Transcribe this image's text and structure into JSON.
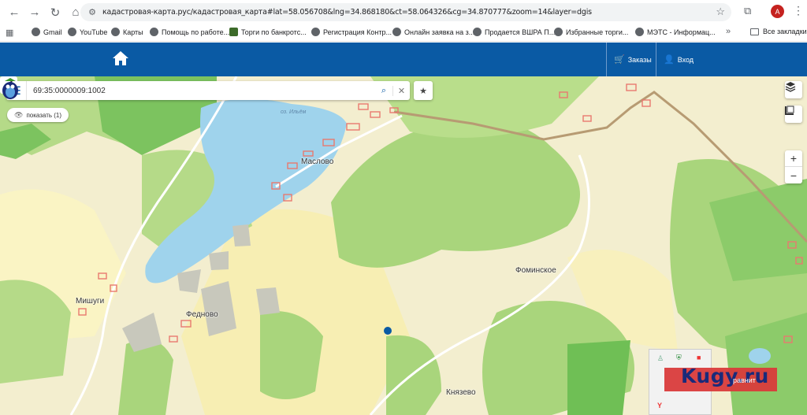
{
  "browser": {
    "url": "кадастровая-карта.рус/кадастровая_карта#lat=58.056708&lng=34.868180&ct=58.064326&cg=34.870777&zoom=14&layer=dgis",
    "avatar_letter": "A",
    "bookmarks": [
      "Gmail",
      "YouTube",
      "Карты",
      "Помощь по работе...",
      "Торги по банкротс...",
      "Регистрация Контр...",
      "Онлайн заявка на з...",
      "Продается ВШРА П...",
      "Избранные торги...",
      "МЭТС - Информац..."
    ],
    "all_bookmarks": "Все закладки",
    "more": "»"
  },
  "header": {
    "orders_label": "Заказы",
    "login_label": "Вход",
    "bg_color": "#0a5aa4"
  },
  "search": {
    "value": "69:35:0000009:1002"
  },
  "show_button": {
    "label": "показать (1)"
  },
  "map": {
    "places": [
      "Маслово",
      "Мишуги",
      "Федново",
      "Фоминское",
      "Князево"
    ],
    "lake_name": "оз. Ильём"
  },
  "widget": {
    "brand": "Kugy.ru",
    "sub": "равнит"
  }
}
